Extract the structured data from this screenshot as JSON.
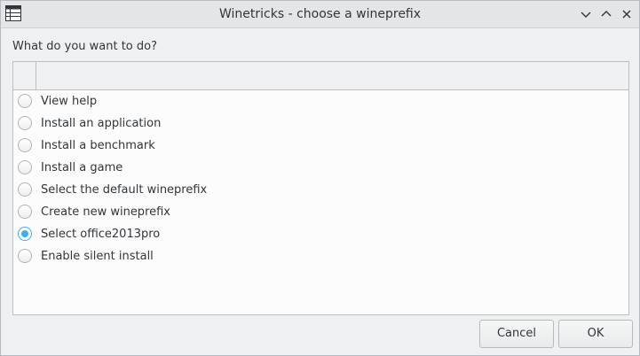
{
  "window": {
    "title": "Winetricks - choose a wineprefix",
    "icon": "table-grid-icon",
    "controls": [
      "minimize-icon",
      "maximize-icon",
      "close-icon"
    ]
  },
  "prompt": "What do you want to do?",
  "options": [
    {
      "label": "View help",
      "selected": false
    },
    {
      "label": "Install an application",
      "selected": false
    },
    {
      "label": "Install a benchmark",
      "selected": false
    },
    {
      "label": "Install a game",
      "selected": false
    },
    {
      "label": "Select the default wineprefix",
      "selected": false
    },
    {
      "label": "Create new wineprefix",
      "selected": false
    },
    {
      "label": "Select office2013pro",
      "selected": true
    },
    {
      "label": "Enable silent install",
      "selected": false
    }
  ],
  "buttons": {
    "cancel": "Cancel",
    "ok": "OK"
  },
  "colors": {
    "accent": "#3daee9",
    "background": "#eff0f1",
    "text": "#31363b"
  }
}
